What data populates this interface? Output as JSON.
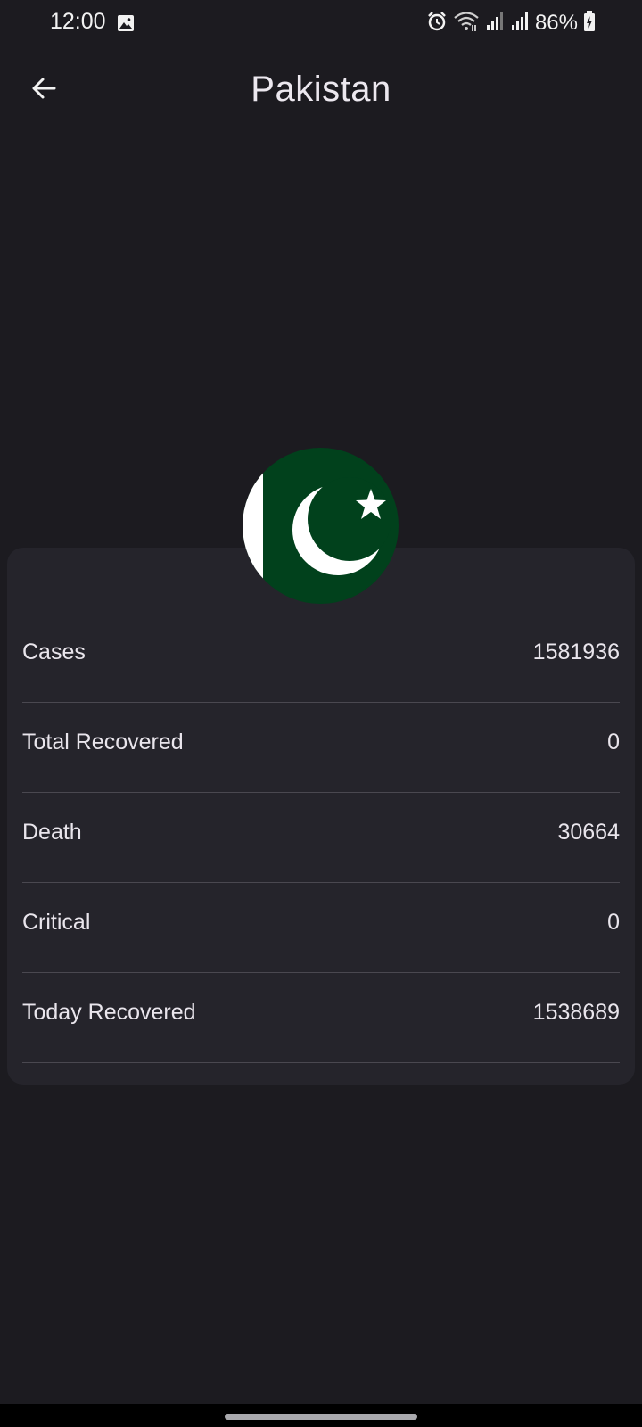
{
  "status_bar": {
    "time": "12:00",
    "battery": "86%",
    "icons": [
      "gallery-icon",
      "alarm-icon",
      "wifi-icon",
      "signal-icon",
      "signal-icon",
      "battery-charging-icon"
    ]
  },
  "app_bar": {
    "title": "Pakistan",
    "back_icon": "arrow-left-icon"
  },
  "flag": {
    "name": "pakistan-flag",
    "colors": {
      "green": "#01411c",
      "white": "#ffffff"
    }
  },
  "stats": [
    {
      "label": "Cases",
      "value": "1581936"
    },
    {
      "label": "Total Recovered",
      "value": "0"
    },
    {
      "label": "Death",
      "value": "30664"
    },
    {
      "label": "Critical",
      "value": "0"
    },
    {
      "label": "Today Recovered",
      "value": "1538689"
    }
  ],
  "colors": {
    "background": "#1c1b20",
    "card": "#25242b",
    "divider": "#4a4850",
    "text": "#e9e5ec"
  }
}
